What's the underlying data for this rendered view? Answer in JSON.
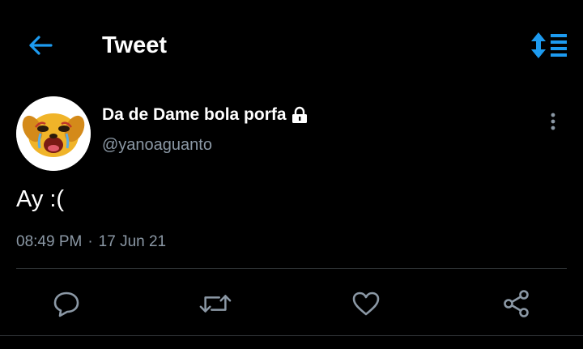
{
  "header": {
    "title": "Tweet",
    "back_icon": "arrow-left-icon",
    "sort_icon": "sort-list-icon"
  },
  "tweet": {
    "display_name": "Da de Dame bola porfa",
    "protected_icon": "lock-icon",
    "handle": "@yanoaguanto",
    "text": "Ay :(",
    "time": "08:49 PM",
    "separator": "·",
    "date": "17 Jun 21",
    "more_icon": "vertical-dots-icon"
  },
  "actions": {
    "reply_icon": "reply-bubble-icon",
    "retweet_icon": "retweet-icon",
    "like_icon": "heart-icon",
    "share_icon": "share-icon"
  },
  "colors": {
    "background": "#000000",
    "accent": "#1d9bf0",
    "text_primary": "#ffffff",
    "text_secondary": "#8b98a5",
    "icon_muted": "#8b98a5",
    "divider": "#2f3336"
  }
}
